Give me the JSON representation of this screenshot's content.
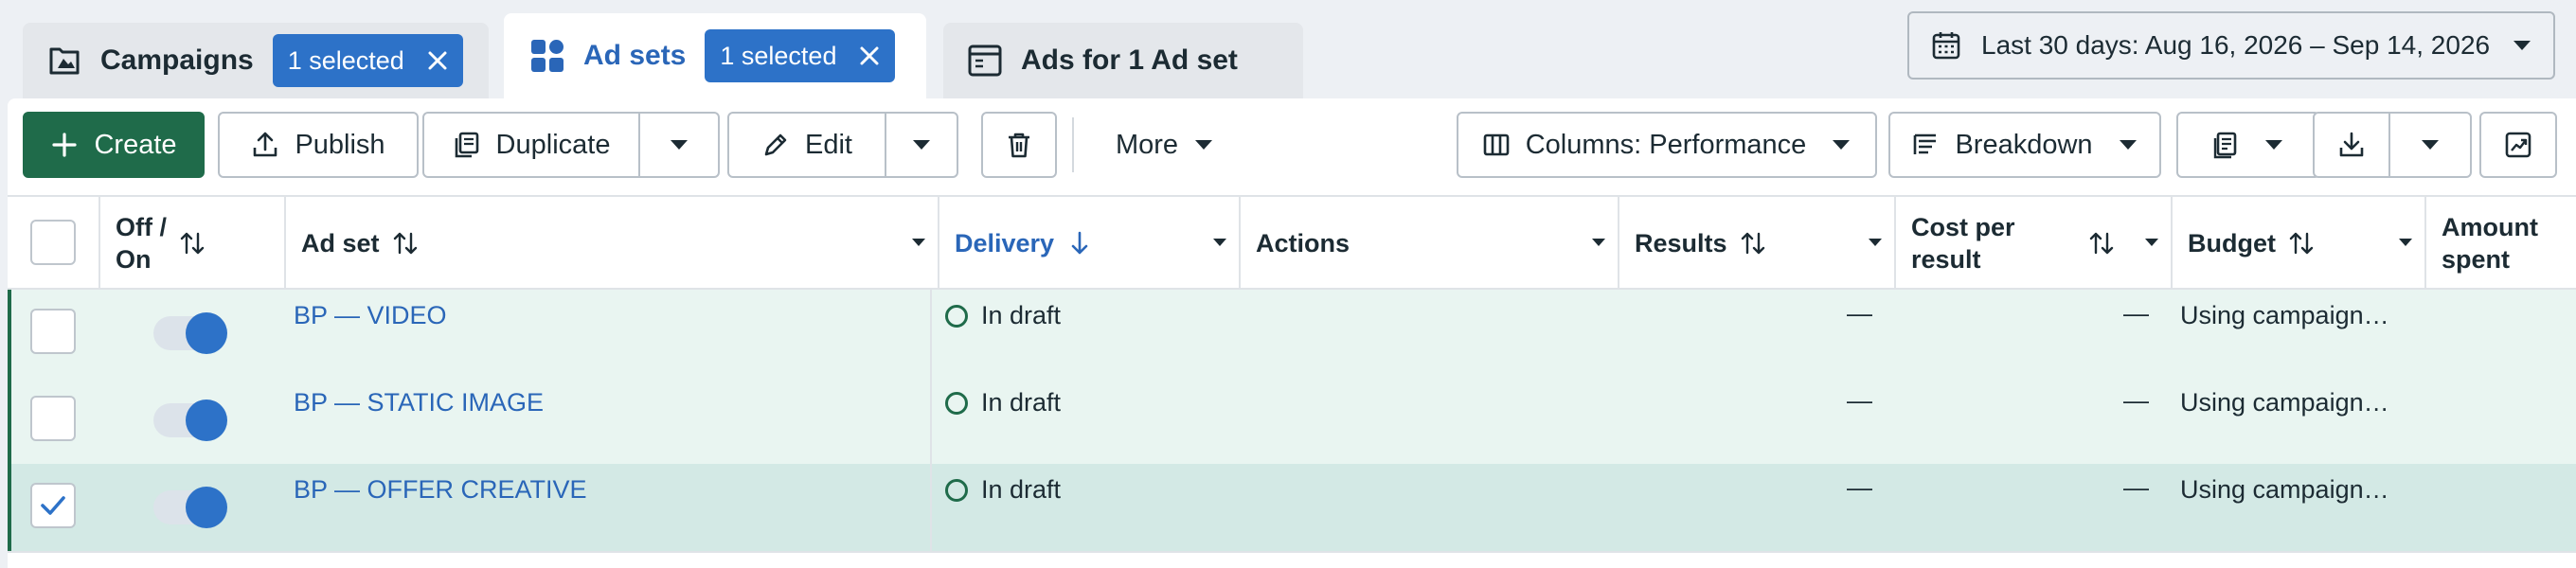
{
  "tabs": {
    "campaigns": {
      "label": "Campaigns",
      "selected": "1 selected"
    },
    "adsets": {
      "label": "Ad sets",
      "selected": "1 selected"
    },
    "ads": {
      "label": "Ads for 1 Ad set"
    }
  },
  "date_range": {
    "label": "Last 30 days: Aug 16, 2026 – Sep 14, 2026"
  },
  "toolbar": {
    "create": "Create",
    "publish": "Publish",
    "duplicate": "Duplicate",
    "edit": "Edit",
    "more": "More",
    "columns": "Columns: Performance",
    "breakdown": "Breakdown"
  },
  "table": {
    "headers": {
      "off_on": [
        "Off /",
        "On"
      ],
      "adset": "Ad set",
      "delivery": "Delivery",
      "actions": "Actions",
      "results": "Results",
      "cost_per_result": [
        "Cost per",
        "result"
      ],
      "budget": "Budget",
      "amount_spent": [
        "Amount",
        "spent"
      ]
    },
    "rows": [
      {
        "name": "BP — VIDEO",
        "delivery": "In draft",
        "results": "—",
        "cost": "—",
        "budget": "Using campaign…",
        "checked": false,
        "on": true
      },
      {
        "name": "BP — STATIC IMAGE",
        "delivery": "In draft",
        "results": "—",
        "cost": "—",
        "budget": "Using campaign…",
        "checked": false,
        "on": true
      },
      {
        "name": "BP — OFFER CREATIVE",
        "delivery": "In draft",
        "results": "—",
        "cost": "—",
        "budget": "Using campaign…",
        "checked": true,
        "on": true
      }
    ]
  },
  "colors": {
    "accent": "#2d72c8",
    "create_button": "#1f6b4a",
    "row_background": "#e9f5f1",
    "selected_row_background": "#d3e9e5",
    "link": "#2a66b8"
  },
  "icons": [
    "campaign-flag-icon",
    "ad-sets-grid-icon",
    "ads-window-icon",
    "calendar-icon",
    "plus-icon",
    "upload-icon",
    "duplicate-icon",
    "pencil-icon",
    "trash-icon",
    "columns-icon",
    "breakdown-icon",
    "report-icon",
    "download-icon",
    "chart-icon"
  ]
}
